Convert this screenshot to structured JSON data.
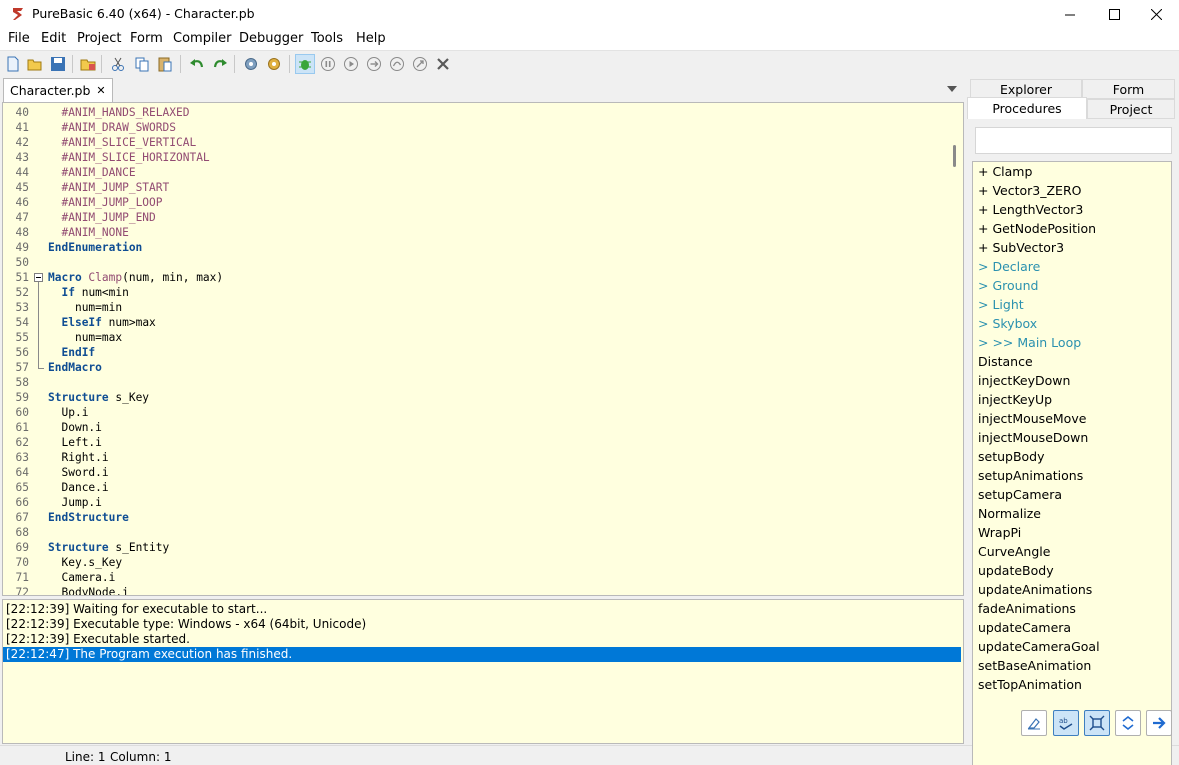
{
  "window": {
    "title": "PureBasic 6.40 (x64) - Character.pb"
  },
  "menu": [
    "File",
    "Edit",
    "Project",
    "Form",
    "Compiler",
    "Debugger",
    "Tools",
    "Help"
  ],
  "toolbar_icons": [
    "new-file-icon",
    "open-file-icon",
    "save-icon",
    "save-all-icon",
    "cut-icon",
    "copy-icon",
    "paste-icon",
    "undo-icon",
    "redo-icon",
    "compile-run-icon",
    "compiler-options-icon",
    "debugger-icon",
    "pause-icon",
    "resume-icon",
    "step-icon",
    "step-over-icon",
    "step-out-icon",
    "kill-program-icon"
  ],
  "file_tab": {
    "label": "Character.pb",
    "close": "✕"
  },
  "code_lines": [
    {
      "n": "40",
      "indent": "  ",
      "tokens": [
        {
          "t": "const",
          "s": "#ANIM_HANDS_RELAXED"
        }
      ]
    },
    {
      "n": "41",
      "indent": "  ",
      "tokens": [
        {
          "t": "const",
          "s": "#ANIM_DRAW_SWORDS"
        }
      ]
    },
    {
      "n": "42",
      "indent": "  ",
      "tokens": [
        {
          "t": "const",
          "s": "#ANIM_SLICE_VERTICAL"
        }
      ]
    },
    {
      "n": "43",
      "indent": "  ",
      "tokens": [
        {
          "t": "const",
          "s": "#ANIM_SLICE_HORIZONTAL"
        }
      ]
    },
    {
      "n": "44",
      "indent": "  ",
      "tokens": [
        {
          "t": "const",
          "s": "#ANIM_DANCE"
        }
      ]
    },
    {
      "n": "45",
      "indent": "  ",
      "tokens": [
        {
          "t": "const",
          "s": "#ANIM_JUMP_START"
        }
      ]
    },
    {
      "n": "46",
      "indent": "  ",
      "tokens": [
        {
          "t": "const",
          "s": "#ANIM_JUMP_LOOP"
        }
      ]
    },
    {
      "n": "47",
      "indent": "  ",
      "tokens": [
        {
          "t": "const",
          "s": "#ANIM_JUMP_END"
        }
      ]
    },
    {
      "n": "48",
      "indent": "  ",
      "tokens": [
        {
          "t": "const",
          "s": "#ANIM_NONE"
        }
      ]
    },
    {
      "n": "49",
      "indent": "",
      "tokens": [
        {
          "t": "kw",
          "s": "EndEnumeration"
        }
      ]
    },
    {
      "n": "50",
      "indent": "",
      "tokens": []
    },
    {
      "n": "51",
      "indent": "",
      "fold": "start",
      "tokens": [
        {
          "t": "kw",
          "s": "Macro"
        },
        {
          "t": "const",
          "s": " Clamp"
        },
        {
          "t": "plain",
          "s": "(num, min, max)"
        }
      ]
    },
    {
      "n": "52",
      "indent": "  ",
      "fold": "mid",
      "tokens": [
        {
          "t": "kw",
          "s": "If"
        },
        {
          "t": "plain",
          "s": " num<min"
        }
      ]
    },
    {
      "n": "53",
      "indent": "    ",
      "fold": "mid",
      "tokens": [
        {
          "t": "plain",
          "s": "num=min"
        }
      ]
    },
    {
      "n": "54",
      "indent": "  ",
      "fold": "mid",
      "tokens": [
        {
          "t": "kw",
          "s": "ElseIf"
        },
        {
          "t": "plain",
          "s": " num>max"
        }
      ]
    },
    {
      "n": "55",
      "indent": "    ",
      "fold": "mid",
      "tokens": [
        {
          "t": "plain",
          "s": "num=max"
        }
      ]
    },
    {
      "n": "56",
      "indent": "  ",
      "fold": "mid",
      "tokens": [
        {
          "t": "kw",
          "s": "EndIf"
        }
      ]
    },
    {
      "n": "57",
      "indent": "",
      "fold": "end",
      "tokens": [
        {
          "t": "kw",
          "s": "EndMacro"
        }
      ]
    },
    {
      "n": "58",
      "indent": "",
      "tokens": []
    },
    {
      "n": "59",
      "indent": "",
      "tokens": [
        {
          "t": "kw",
          "s": "Structure"
        },
        {
          "t": "plain",
          "s": " s_Key"
        }
      ]
    },
    {
      "n": "60",
      "indent": "  ",
      "tokens": [
        {
          "t": "plain",
          "s": "Up.i"
        }
      ]
    },
    {
      "n": "61",
      "indent": "  ",
      "tokens": [
        {
          "t": "plain",
          "s": "Down.i"
        }
      ]
    },
    {
      "n": "62",
      "indent": "  ",
      "tokens": [
        {
          "t": "plain",
          "s": "Left.i"
        }
      ]
    },
    {
      "n": "63",
      "indent": "  ",
      "tokens": [
        {
          "t": "plain",
          "s": "Right.i"
        }
      ]
    },
    {
      "n": "64",
      "indent": "  ",
      "tokens": [
        {
          "t": "plain",
          "s": "Sword.i"
        }
      ]
    },
    {
      "n": "65",
      "indent": "  ",
      "tokens": [
        {
          "t": "plain",
          "s": "Dance.i"
        }
      ]
    },
    {
      "n": "66",
      "indent": "  ",
      "tokens": [
        {
          "t": "plain",
          "s": "Jump.i"
        }
      ]
    },
    {
      "n": "67",
      "indent": "",
      "tokens": [
        {
          "t": "kw",
          "s": "EndStructure"
        }
      ]
    },
    {
      "n": "68",
      "indent": "",
      "tokens": []
    },
    {
      "n": "69",
      "indent": "",
      "tokens": [
        {
          "t": "kw",
          "s": "Structure"
        },
        {
          "t": "plain",
          "s": " s_Entity"
        }
      ]
    },
    {
      "n": "70",
      "indent": "  ",
      "tokens": [
        {
          "t": "plain",
          "s": "Key.s_Key"
        }
      ]
    },
    {
      "n": "71",
      "indent": "  ",
      "tokens": [
        {
          "t": "plain",
          "s": "Camera.i"
        }
      ]
    },
    {
      "n": "72",
      "indent": "  ",
      "tokens": [
        {
          "t": "plain",
          "s": "BodyNode.i"
        }
      ]
    }
  ],
  "output_lines": [
    {
      "text": "[22:12:39] Waiting for executable to start...",
      "selected": false
    },
    {
      "text": "[22:12:39] Executable type: Windows - x64  (64bit, Unicode)",
      "selected": false
    },
    {
      "text": "[22:12:39] Executable started.",
      "selected": false
    },
    {
      "text": "[22:12:47] The Program execution has finished.",
      "selected": true
    }
  ],
  "status": {
    "line": "Line: 1",
    "column": "Column: 1"
  },
  "panel_tabs": {
    "explorer": "Explorer",
    "form": "Form",
    "procedures": "Procedures",
    "project": "Project"
  },
  "procedures": [
    {
      "label": "+ Clamp",
      "type": "macro"
    },
    {
      "label": "+ Vector3_ZERO",
      "type": "macro"
    },
    {
      "label": "+ LengthVector3",
      "type": "macro"
    },
    {
      "label": "+ GetNodePosition",
      "type": "macro"
    },
    {
      "label": "+ SubVector3",
      "type": "macro"
    },
    {
      "label": "> Declare",
      "type": "marker"
    },
    {
      "label": "> Ground",
      "type": "marker"
    },
    {
      "label": "> Light",
      "type": "marker"
    },
    {
      "label": "> Skybox",
      "type": "marker"
    },
    {
      "label": "> >> Main Loop",
      "type": "marker"
    },
    {
      "label": "Distance",
      "type": "proc"
    },
    {
      "label": "injectKeyDown",
      "type": "proc"
    },
    {
      "label": "injectKeyUp",
      "type": "proc"
    },
    {
      "label": "injectMouseMove",
      "type": "proc"
    },
    {
      "label": "injectMouseDown",
      "type": "proc"
    },
    {
      "label": "setupBody",
      "type": "proc"
    },
    {
      "label": "setupAnimations",
      "type": "proc"
    },
    {
      "label": "setupCamera",
      "type": "proc"
    },
    {
      "label": "Normalize",
      "type": "proc"
    },
    {
      "label": "WrapPi",
      "type": "proc"
    },
    {
      "label": "CurveAngle",
      "type": "proc"
    },
    {
      "label": "updateBody",
      "type": "proc"
    },
    {
      "label": "updateAnimations",
      "type": "proc"
    },
    {
      "label": "fadeAnimations",
      "type": "proc"
    },
    {
      "label": "updateCamera",
      "type": "proc"
    },
    {
      "label": "updateCameraGoal",
      "type": "proc"
    },
    {
      "label": "setBaseAnimation",
      "type": "proc"
    },
    {
      "label": "setTopAnimation",
      "type": "proc"
    }
  ],
  "panel_buttons": [
    "clear-icon",
    "spellcheck-icon",
    "fit-icon",
    "collapse-expand-icon",
    "goto-arrow-icon"
  ],
  "colors": {
    "editor_bg": "#ffffdf",
    "keyword": "#0f4d93",
    "constant": "#924b72",
    "marker": "#2b91af",
    "selection": "#0078d7"
  }
}
